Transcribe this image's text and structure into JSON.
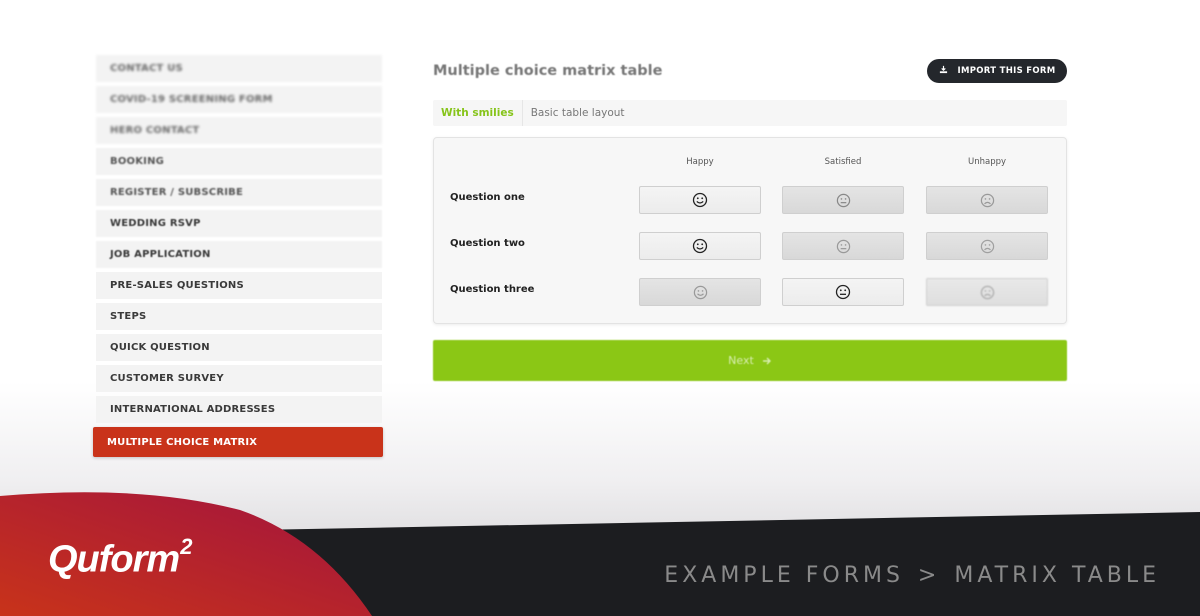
{
  "sidebar": {
    "items": [
      {
        "label": "CONTACT US"
      },
      {
        "label": "COVID-19 SCREENING FORM"
      },
      {
        "label": "HERO CONTACT"
      },
      {
        "label": "BOOKING"
      },
      {
        "label": "REGISTER / SUBSCRIBE"
      },
      {
        "label": "WEDDING RSVP"
      },
      {
        "label": "JOB APPLICATION"
      },
      {
        "label": "PRE-SALES QUESTIONS"
      },
      {
        "label": "STEPS"
      },
      {
        "label": "QUICK QUESTION"
      },
      {
        "label": "CUSTOMER SURVEY"
      },
      {
        "label": "INTERNATIONAL ADDRESSES"
      },
      {
        "label": "MULTIPLE CHOICE MATRIX"
      }
    ],
    "active_index": 12
  },
  "main": {
    "title": "Multiple choice matrix table",
    "import_button": {
      "label": "IMPORT THIS FORM",
      "icon": "import-icon"
    },
    "tabs": [
      {
        "label": "With smilies",
        "active": true
      },
      {
        "label": "Basic table layout",
        "active": false
      }
    ],
    "matrix": {
      "columns": [
        "Happy",
        "Satisfied",
        "Unhappy"
      ],
      "rows": [
        {
          "label": "Question one",
          "selected": "Happy"
        },
        {
          "label": "Question two",
          "selected": "Happy"
        },
        {
          "label": "Question three",
          "selected": "Satisfied"
        }
      ],
      "icons": [
        "smile-icon",
        "neutral-face-icon",
        "frown-icon"
      ]
    },
    "next_button": {
      "label": "Next",
      "icon": "arrow-right-icon"
    }
  },
  "footer": {
    "brand": "Quform",
    "brand_superscript": "2",
    "breadcrumb": [
      "EXAMPLE FORMS",
      "MATRIX TABLE"
    ],
    "breadcrumb_separator": ">"
  },
  "colors": {
    "accent_green": "#8bc715",
    "active_red": "#c9331a",
    "dark": "#1c1d20",
    "tab_active": "#86c41a"
  }
}
